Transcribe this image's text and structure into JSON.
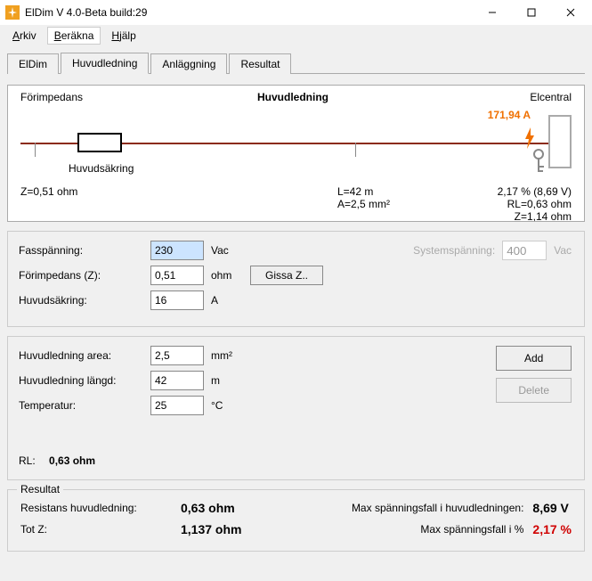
{
  "window": {
    "title": "ElDim V 4.0-Beta build:29"
  },
  "menu": {
    "arkiv": "Arkiv",
    "berakna": "Beräkna",
    "hjalp": "Hjälp"
  },
  "tabs": {
    "eldim": "ElDim",
    "huvudledning": "Huvudledning",
    "anlaggning": "Anläggning",
    "resultat": "Resultat"
  },
  "diagram": {
    "forimpedans": "Förimpedans",
    "huvudledning": "Huvudledning",
    "elcentral": "Elcentral",
    "huvudsakring": "Huvudsäkring",
    "z_left": "Z=0,51 ohm",
    "current": "171,94 A",
    "l_value": "L=42 m",
    "a_value": "A=2,5 mm²",
    "pct_value": "2,17 % (8,69 V)",
    "rl_value": "RL=0,63 ohm",
    "z_right": "Z=1,14 ohm"
  },
  "params1": {
    "fassp_label": "Fasspänning:",
    "fassp_value": "230",
    "fassp_unit": "Vac",
    "forimp_label": "Förimpedans (Z):",
    "forimp_value": "0,51",
    "forimp_unit": "ohm",
    "gissa_label": "Gissa Z..",
    "huvsak_label": "Huvudsäkring:",
    "huvsak_value": "16",
    "huvsak_unit": "A",
    "sys_label": "Systemspänning:",
    "sys_value": "400",
    "sys_unit": "Vac"
  },
  "params2": {
    "area_label": "Huvudledning area:",
    "area_value": "2,5",
    "area_unit": "mm²",
    "langd_label": "Huvudledning längd:",
    "langd_value": "42",
    "langd_unit": "m",
    "temp_label": "Temperatur:",
    "temp_value": "25",
    "temp_unit": "°C",
    "add_label": "Add",
    "delete_label": "Delete",
    "rl_label": "RL:",
    "rl_value": "0,63 ohm"
  },
  "result": {
    "legend": "Resultat",
    "resistans_label": "Resistans huvudledning:",
    "resistans_value": "0,63 ohm",
    "maxfall_label": "Max spänningsfall i huvudledningen:",
    "maxfall_value": "8,69 V",
    "totz_label": "Tot Z:",
    "totz_value": "1,137 ohm",
    "maxpct_label": "Max spänningsfall i %",
    "maxpct_value": "2,17 %"
  }
}
